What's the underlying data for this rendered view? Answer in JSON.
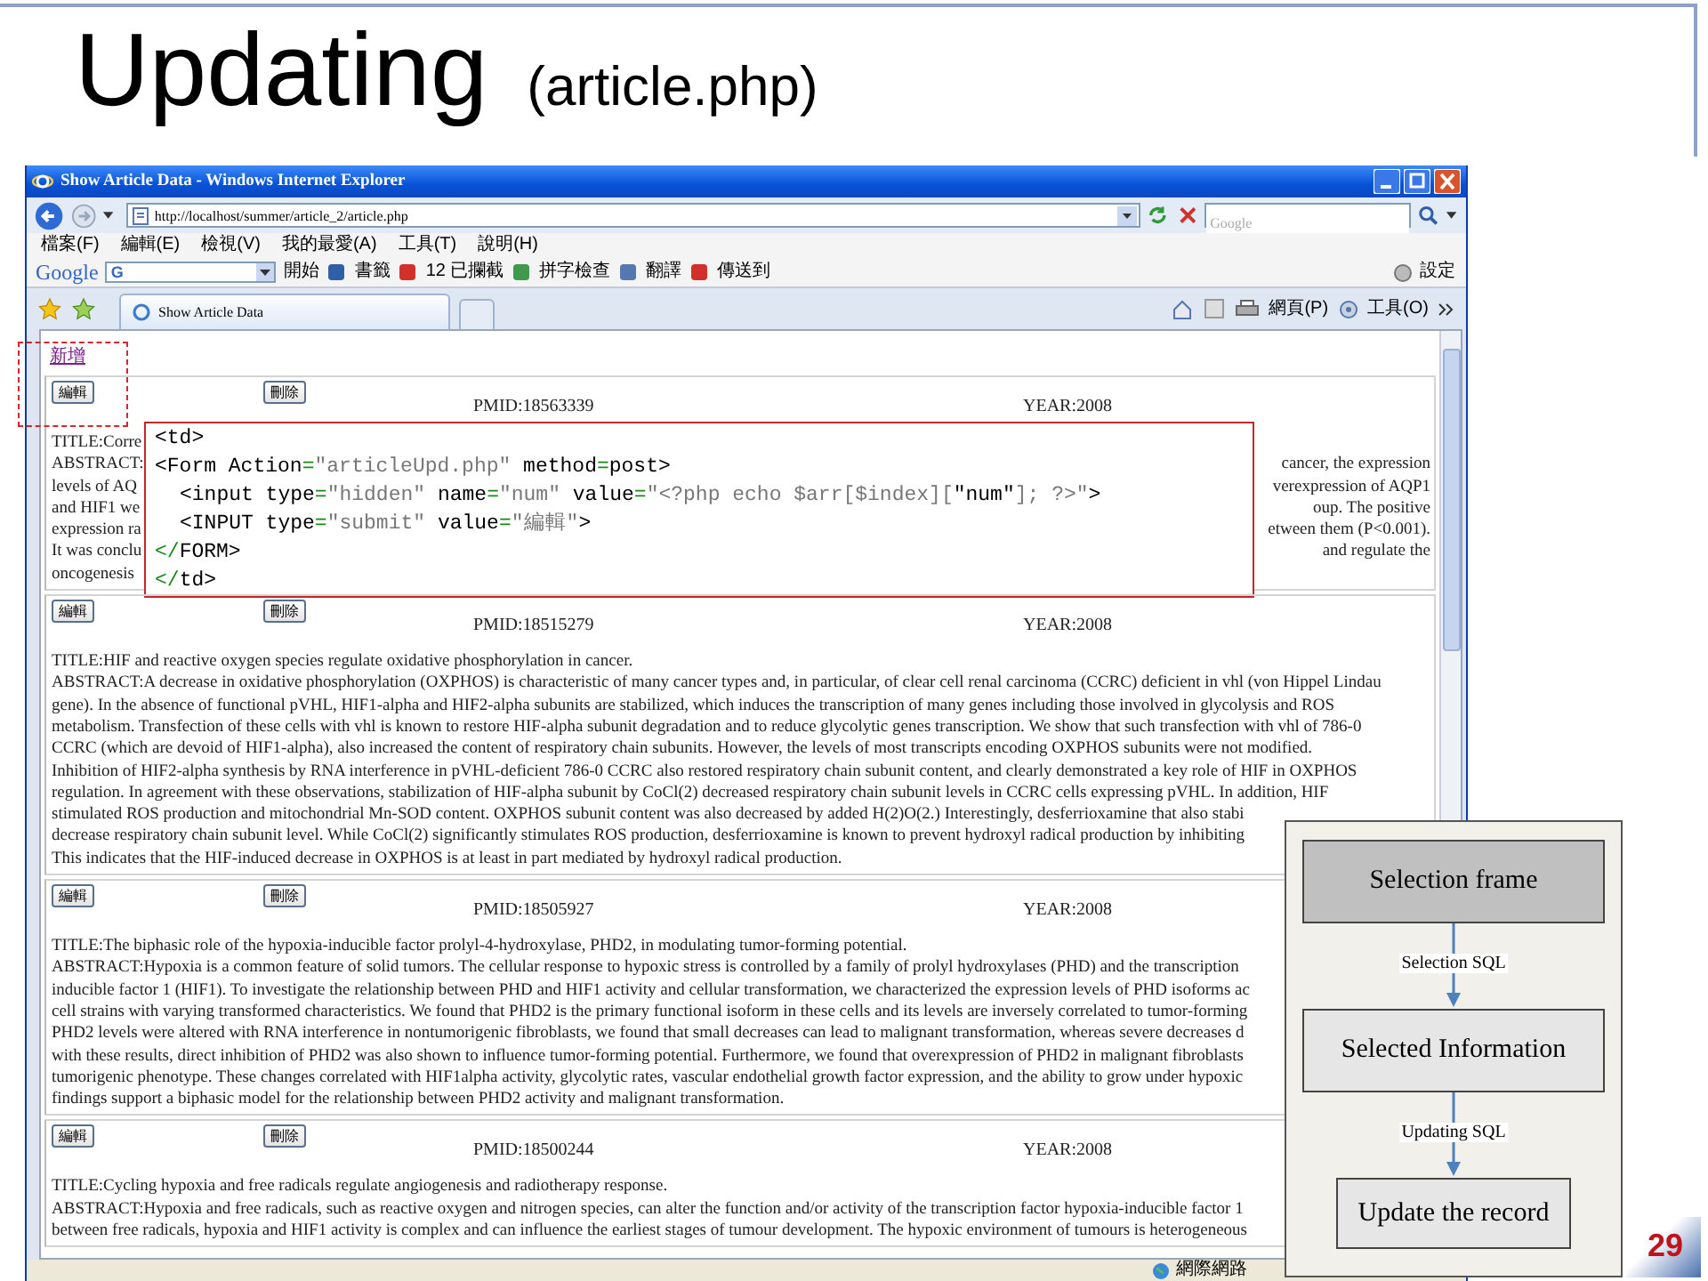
{
  "slide": {
    "title": "Updating",
    "subtitle": "(article.php)",
    "page_number": "29"
  },
  "browser": {
    "window_title": "Show Article Data - Windows Internet Explorer",
    "address": "http://localhost/summer/article_2/article.php",
    "search_placeholder": "Google",
    "menu": [
      "檔案(F)",
      "編輯(E)",
      "檢視(V)",
      "我的最愛(A)",
      "工具(T)",
      "說明(H)"
    ],
    "google_toolbar": {
      "logo": "Google",
      "field_value": "G",
      "items": [
        "開始",
        "書籤",
        "12 已攔截",
        "拼字檢查",
        "翻譯",
        "傳送到"
      ],
      "settings": "設定"
    },
    "tab": {
      "label": "Show Article Data"
    },
    "command_items": [
      "網頁(P)",
      "工具(O)"
    ],
    "status": "網際網路"
  },
  "page": {
    "add_link": "新增",
    "records": [
      {
        "edit_button": "編輯",
        "delete_button": "刪除",
        "pmid": "PMID:18563339",
        "year": "YEAR:2008",
        "title": "TITLE:Corre",
        "abstract_lines": [
          "ABSTRACT:",
          "levels of AQ",
          "and HIF1 we",
          "expression ra",
          "It was conclu",
          "oncogenesis"
        ],
        "abstract_line_ends": [
          "cancer, the expression",
          "verexpression of AQP1",
          "oup. The positive",
          "etween them (P<0.001).",
          "and regulate the"
        ]
      },
      {
        "edit_button": "編輯",
        "delete_button": "刪除",
        "pmid": "PMID:18515279",
        "year": "YEAR:2008",
        "title": "TITLE:HIF and reactive oxygen species regulate oxidative phosphorylation in cancer.",
        "abstract_lines": [
          "ABSTRACT:A decrease in oxidative phosphorylation (OXPHOS) is characteristic of many cancer types and, in particular, of clear cell renal carcinoma (CCRC) deficient in vhl (von Hippel Lindau",
          "gene). In the absence of functional pVHL, HIF1-alpha and HIF2-alpha subunits are stabilized, which induces the transcription of many genes including those involved in glycolysis and ROS",
          "metabolism. Transfection of these cells with vhl is known to restore HIF-alpha subunit degradation and to reduce glycolytic genes transcription. We show that such transfection with vhl of 786-0",
          "CCRC (which are devoid of HIF1-alpha), also increased the content of respiratory chain subunits. However, the levels of most transcripts encoding OXPHOS subunits were not modified.",
          "Inhibition of HIF2-alpha synthesis by RNA interference in pVHL-deficient 786-0 CCRC also restored respiratory chain subunit content, and clearly demonstrated a key role of HIF in OXPHOS",
          "regulation. In agreement with these observations, stabilization of HIF-alpha subunit by CoCl(2) decreased respiratory chain subunit levels in CCRC cells expressing pVHL. In addition, HIF",
          "stimulated ROS production and mitochondrial Mn-SOD content. OXPHOS subunit content was also decreased by added H(2)O(2.) Interestingly, desferrioxamine that also stabi",
          "decrease respiratory chain subunit level. While CoCl(2) significantly stimulates ROS production, desferrioxamine is known to prevent hydroxyl radical production by inhibiting",
          "This indicates that the HIF-induced decrease in OXPHOS is at least in part mediated by hydroxyl radical production."
        ]
      },
      {
        "edit_button": "編輯",
        "delete_button": "刪除",
        "pmid": "PMID:18505927",
        "year": "YEAR:2008",
        "title": "TITLE:The biphasic role of the hypoxia-inducible factor prolyl-4-hydroxylase, PHD2, in modulating tumor-forming potential.",
        "abstract_lines": [
          "ABSTRACT:Hypoxia is a common feature of solid tumors. The cellular response to hypoxic stress is controlled by a family of prolyl hydroxylases (PHD) and the transcription",
          "inducible factor 1 (HIF1). To investigate the relationship between PHD and HIF1 activity and cellular transformation, we characterized the expression levels of PHD isoforms ac",
          "cell strains with varying transformed characteristics. We found that PHD2 is the primary functional isoform in these cells and its levels are inversely correlated to tumor-forming",
          "PHD2 levels were altered with RNA interference in nontumorigenic fibroblasts, we found that small decreases can lead to malignant transformation, whereas severe decreases d",
          "with these results, direct inhibition of PHD2 was also shown to influence tumor-forming potential. Furthermore, we found that overexpression of PHD2 in malignant fibroblasts",
          "tumorigenic phenotype. These changes correlated with HIF1alpha activity, glycolytic rates, vascular endothelial growth factor expression, and the ability to grow under hypoxic",
          "findings support a biphasic model for the relationship between PHD2 activity and malignant transformation."
        ]
      },
      {
        "edit_button": "編輯",
        "delete_button": "刪除",
        "pmid": "PMID:18500244",
        "year": "YEAR:2008",
        "title": "TITLE:Cycling hypoxia and free radicals regulate angiogenesis and radiotherapy response.",
        "abstract_lines": [
          "ABSTRACT:Hypoxia and free radicals, such as reactive oxygen and nitrogen species, can alter the function and/or activity of the transcription factor hypoxia-inducible factor 1",
          "between free radicals, hypoxia and HIF1 activity is complex and can influence the earliest stages of tumour development. The hypoxic environment of tumours is heterogeneous"
        ]
      }
    ]
  },
  "code_callout": {
    "lines": [
      {
        "indented": false,
        "tokens": [
          {
            "kind": "text",
            "text": "<td>"
          }
        ]
      },
      {
        "indented": false,
        "tokens": [
          {
            "kind": "text",
            "text": "<Form Action"
          },
          {
            "kind": "punct",
            "text": "="
          },
          {
            "kind": "string",
            "text": "\"articleUpd.php\""
          },
          {
            "kind": "text",
            "text": " method"
          },
          {
            "kind": "punct",
            "text": "="
          },
          {
            "kind": "text",
            "text": "post>"
          }
        ]
      },
      {
        "indented": true,
        "tokens": [
          {
            "kind": "text",
            "text": "<input type"
          },
          {
            "kind": "punct",
            "text": "="
          },
          {
            "kind": "string",
            "text": "\"hidden\""
          },
          {
            "kind": "text",
            "text": " name"
          },
          {
            "kind": "punct",
            "text": "="
          },
          {
            "kind": "string",
            "text": "\"num\""
          },
          {
            "kind": "text",
            "text": " value"
          },
          {
            "kind": "punct",
            "text": "="
          },
          {
            "kind": "string",
            "text": "\"<?php echo $arr[$index]["
          },
          {
            "kind": "text",
            "text": "\"num\""
          },
          {
            "kind": "string",
            "text": "]; ?>\""
          },
          {
            "kind": "text",
            "text": ">"
          }
        ]
      },
      {
        "indented": true,
        "tokens": [
          {
            "kind": "text",
            "text": "<INPUT type"
          },
          {
            "kind": "punct",
            "text": "="
          },
          {
            "kind": "string",
            "text": "\"submit\""
          },
          {
            "kind": "text",
            "text": " value"
          },
          {
            "kind": "punct",
            "text": "="
          },
          {
            "kind": "string",
            "text": "\"編輯\""
          },
          {
            "kind": "text",
            "text": ">"
          }
        ]
      },
      {
        "indented": false,
        "tokens": [
          {
            "kind": "punct",
            "text": "</"
          },
          {
            "kind": "text",
            "text": "FORM>"
          }
        ]
      },
      {
        "indented": false,
        "tokens": [
          {
            "kind": "punct",
            "text": "</"
          },
          {
            "kind": "text",
            "text": "td>"
          }
        ]
      }
    ]
  },
  "flowchart": {
    "nodes": [
      {
        "label": "Selection frame",
        "kind": "dark"
      },
      {
        "label": "Selected Information",
        "kind": "light"
      },
      {
        "label": "Update the record",
        "kind": "small"
      }
    ],
    "edges": [
      "Selection SQL",
      "Updating SQL"
    ]
  }
}
